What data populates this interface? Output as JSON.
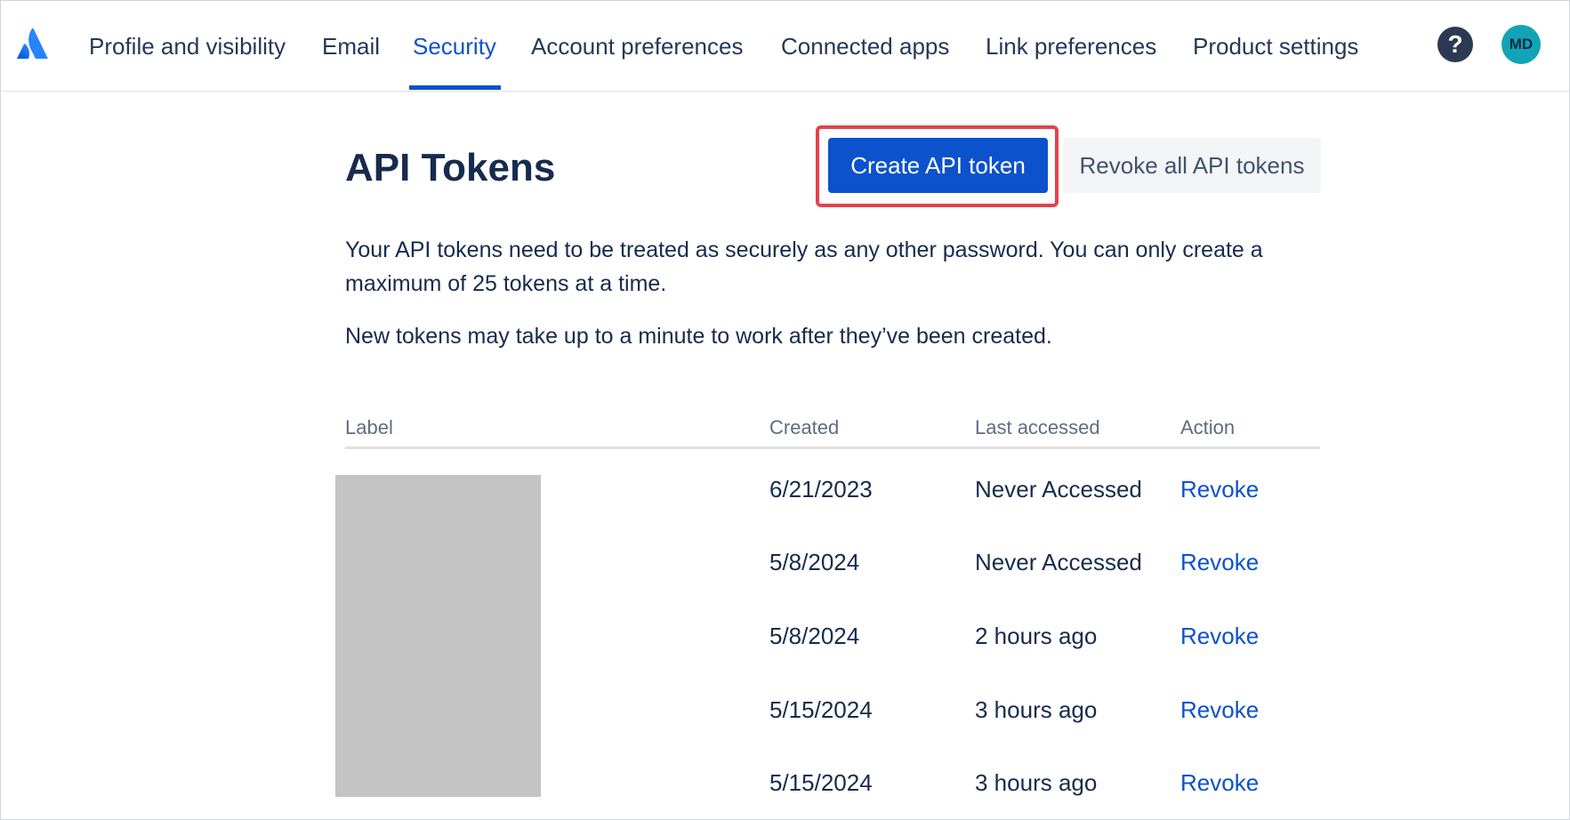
{
  "nav": {
    "items": [
      {
        "label": "Profile and visibility"
      },
      {
        "label": "Email"
      },
      {
        "label": "Security",
        "active": true
      },
      {
        "label": "Account preferences"
      },
      {
        "label": "Connected apps"
      },
      {
        "label": "Link preferences"
      },
      {
        "label": "Product settings"
      }
    ],
    "help_icon": "question-circle-icon",
    "help_glyph": "?",
    "avatar_initials": "MD"
  },
  "page": {
    "title": "API Tokens",
    "create_button": "Create API token",
    "revoke_all_button": "Revoke all API tokens",
    "description": "Your API tokens need to be treated as securely as any other password. You can only create a maximum of 25 tokens at a time.",
    "note": "New tokens may take up to a minute to work after they’ve been created."
  },
  "table": {
    "headers": {
      "label": "Label",
      "created": "Created",
      "last_accessed": "Last accessed",
      "action": "Action"
    },
    "rows": [
      {
        "created": "6/21/2023",
        "last_accessed": "Never Accessed",
        "action": "Revoke"
      },
      {
        "created": "5/8/2024",
        "last_accessed": "Never Accessed",
        "action": "Revoke"
      },
      {
        "created": "5/8/2024",
        "last_accessed": "2 hours ago",
        "action": "Revoke"
      },
      {
        "created": "5/15/2024",
        "last_accessed": "3 hours ago",
        "action": "Revoke"
      },
      {
        "created": "5/15/2024",
        "last_accessed": "3 hours ago",
        "action": "Revoke"
      }
    ]
  },
  "colors": {
    "brand_blue": "#0c52cc",
    "highlight_red": "#e5414b",
    "text": "#172b4d",
    "avatar_bg": "#12a4b5",
    "redaction": "#c4c4c4"
  }
}
